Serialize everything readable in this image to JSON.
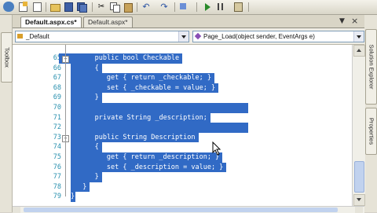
{
  "toolbar": {
    "icons": [
      "back-icon",
      "new-project-icon",
      "add-item-icon",
      "open-icon",
      "save-icon",
      "save-all-icon",
      "cut-icon",
      "copy-icon",
      "paste-icon",
      "undo-icon",
      "redo-icon",
      "navigate-icon",
      "start-icon",
      "pause-icon",
      "find-icon"
    ]
  },
  "left_strip": {
    "toolbox_label": "Toolbox"
  },
  "right_strip": {
    "solution_explorer_label": "Solution Explorer",
    "properties_label": "Properties"
  },
  "tabs": [
    {
      "label": "Default.aspx.cs*",
      "active": true
    },
    {
      "label": "Default.aspx*",
      "active": false
    }
  ],
  "tab_controls": {
    "dropdown": "▼",
    "close": "×"
  },
  "navigation": {
    "class_combo": "_Default",
    "member_combo": "Page_Load(object sender, EventArgs e)"
  },
  "editor": {
    "lines": [
      {
        "num": "65",
        "text": "public bool Checkable",
        "indent": 2
      },
      {
        "num": "66",
        "text": "{",
        "indent": 2
      },
      {
        "num": "67",
        "text": "get { return _checkable; }",
        "indent": 3
      },
      {
        "num": "68",
        "text": "set { _checkable = value; }",
        "indent": 3
      },
      {
        "num": "69",
        "text": "}",
        "indent": 2
      },
      {
        "num": "70",
        "text": "",
        "indent": 2
      },
      {
        "num": "71",
        "text": "private String _description;",
        "indent": 2
      },
      {
        "num": "72",
        "text": "",
        "indent": 2
      },
      {
        "num": "73",
        "text": "public String Description",
        "indent": 2
      },
      {
        "num": "74",
        "text": "{",
        "indent": 2
      },
      {
        "num": "75",
        "text": "get { return _description; }",
        "indent": 3
      },
      {
        "num": "76",
        "text": "set { _description = value; }",
        "indent": 3
      },
      {
        "num": "77",
        "text": "}",
        "indent": 2
      },
      {
        "num": "78",
        "text": "}",
        "indent": 1
      },
      {
        "num": "79",
        "text": "}",
        "indent": 0
      }
    ],
    "selection_color": "#316ac5",
    "line_number_color": "#2b91af"
  }
}
